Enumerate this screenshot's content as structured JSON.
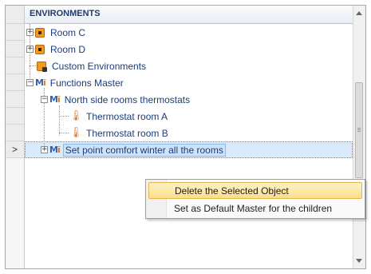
{
  "header": {
    "title": "ENVIRONMENTS"
  },
  "row_header": {
    "current_marker": ">"
  },
  "tree": {
    "nodes": [
      {
        "label": "Room C",
        "expander": "+"
      },
      {
        "label": "Room D",
        "expander": "+"
      },
      {
        "label": "Custom Environments"
      },
      {
        "label": "Functions Master",
        "expander": "−"
      },
      {
        "label": "North side rooms thermostats",
        "expander": "−"
      },
      {
        "label": "Thermostat room A"
      },
      {
        "label": "Thermostat room B"
      },
      {
        "label": "Set point comfort winter all the rooms",
        "expander": "+"
      }
    ]
  },
  "context_menu": {
    "items": [
      {
        "label": "Delete the Selected Object"
      },
      {
        "label": "Set as Default Master for the children"
      }
    ]
  },
  "icons": {
    "room": "room-icon",
    "custom": "custom-environment-icon",
    "function": "function-master-icon",
    "thermostat": "thermostat-icon"
  },
  "colors": {
    "header_text": "#1f3a6e",
    "node_text": "#1e3c78",
    "room_icon": "#f39a1e",
    "selection": "#cde3fa",
    "menu_highlight": "#fbdf8a"
  }
}
